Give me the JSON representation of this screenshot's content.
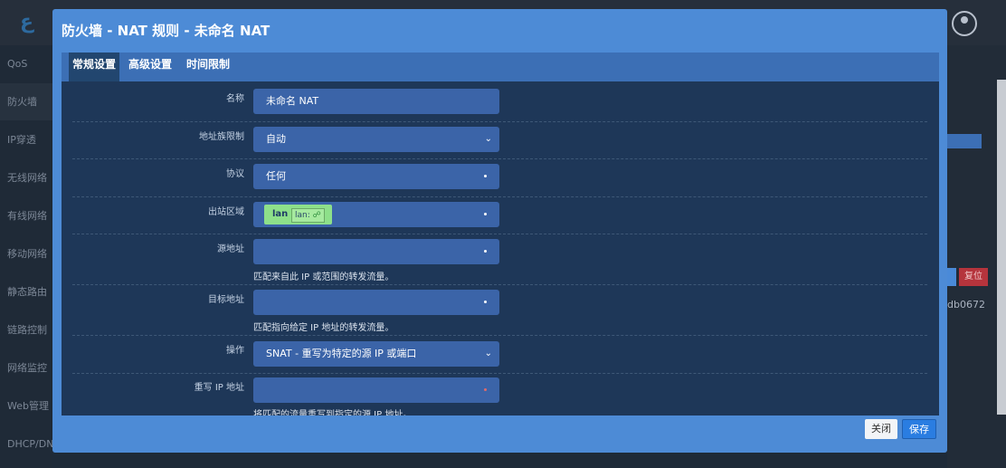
{
  "background": {
    "logo": "ع",
    "sidebar": [
      "QoS",
      "防火墙",
      "IP穿透",
      "无线网络",
      "有线网络",
      "移动网络",
      "静态路由",
      "链路控制",
      "网络监控",
      "Web管理",
      "DHCP/DNS"
    ],
    "right_button": "复位",
    "right_text": "db0672"
  },
  "modal": {
    "title": "防火墙 - NAT 规则 - 未命名 NAT",
    "tabs": [
      "常规设置",
      "高级设置",
      "时间限制"
    ],
    "fields": {
      "name": {
        "label": "名称",
        "value": "未命名 NAT"
      },
      "family": {
        "label": "地址族限制",
        "value": "自动"
      },
      "protocol": {
        "label": "协议",
        "value": "任何"
      },
      "out_zone": {
        "label": "出站区域",
        "zone": "lan",
        "iface": "lan:"
      },
      "src": {
        "label": "源地址",
        "value": "",
        "hint": "匹配来自此 IP 或范围的转发流量。"
      },
      "dst": {
        "label": "目标地址",
        "value": "",
        "hint": "匹配指向给定 IP 地址的转发流量。"
      },
      "action": {
        "label": "操作",
        "value": "SNAT - 重写为特定的源 IP 或端口"
      },
      "rewrite_ip": {
        "label": "重写 IP 地址",
        "value": "",
        "hint": "将匹配的流量重写到指定的源 IP 地址。"
      }
    },
    "buttons": {
      "close": "关闭",
      "save": "保存"
    }
  },
  "icons": {
    "dropdown": "chevron-down-icon",
    "avatar": "user-avatar-icon",
    "plug": "network-plug-icon"
  }
}
